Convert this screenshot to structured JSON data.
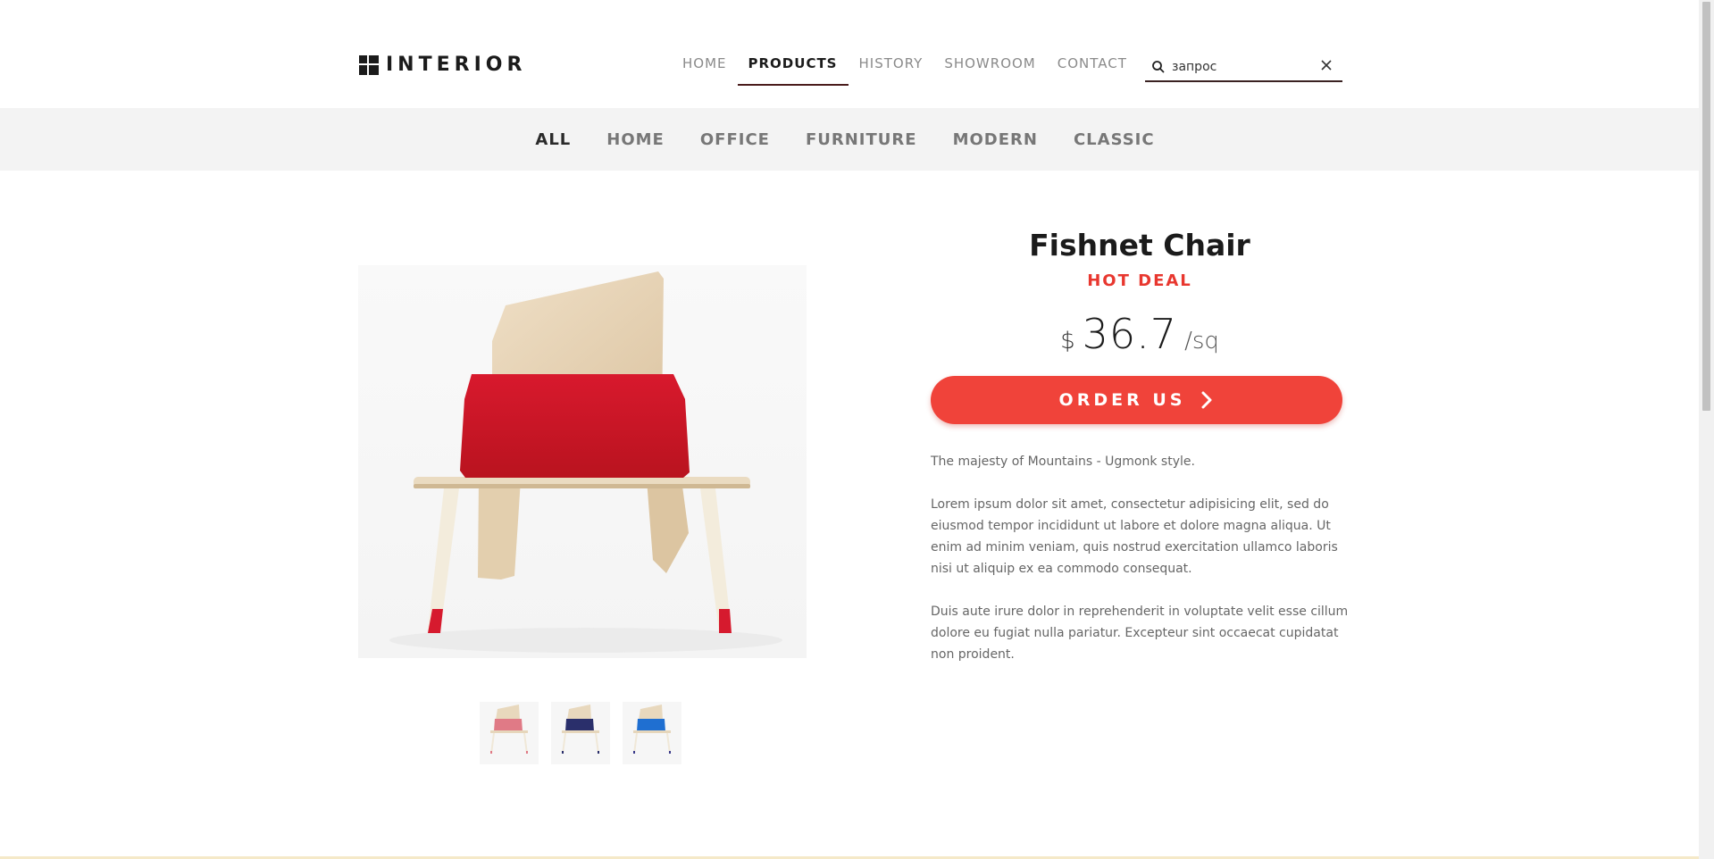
{
  "header": {
    "logo_text": "INTERIOR",
    "nav": [
      {
        "label": "HOME",
        "active": false
      },
      {
        "label": "PRODUCTS",
        "active": true
      },
      {
        "label": "HISTORY",
        "active": false
      },
      {
        "label": "SHOWROOM",
        "active": false
      },
      {
        "label": "CONTACT",
        "active": false
      }
    ],
    "search": {
      "value": "запрос",
      "icon": "search-icon",
      "clear_icon": "close-icon"
    }
  },
  "categories": [
    {
      "label": "ALL",
      "active": true
    },
    {
      "label": "HOME",
      "active": false
    },
    {
      "label": "OFFICE",
      "active": false
    },
    {
      "label": "FURNITURE",
      "active": false
    },
    {
      "label": "MODERN",
      "active": false
    },
    {
      "label": "CLASSIC",
      "active": false
    }
  ],
  "product": {
    "title": "Fishnet Chair",
    "badge": "HOT DEAL",
    "currency": "$",
    "price": "36.7",
    "unit": "/sq",
    "order_label": "ORDER US",
    "tagline": "The majesty of Mountains - Ugmonk style.",
    "paragraph_1": "Lorem ipsum dolor sit amet, consectetur adipisicing elit, sed do eiusmod tempor incididunt ut labore et dolore magna aliqua. Ut enim ad minim veniam, quis nostrud exercitation ullamco laboris nisi ut aliquip ex ea commodo consequat.",
    "paragraph_2": "Duis aute irure dolor in reprehenderit in voluptate velit esse cillum dolore eu fugiat nulla pariatur. Excepteur sint occaecat cupidatat non proident.",
    "thumbnails": [
      {
        "seat_color": "#e07a86"
      },
      {
        "seat_color": "#2a2f6b"
      },
      {
        "seat_color": "#1f6fd1"
      }
    ]
  },
  "colors": {
    "accent": "#f0433a",
    "badge": "#e8372f",
    "category_bar": "#f3f3f3"
  }
}
